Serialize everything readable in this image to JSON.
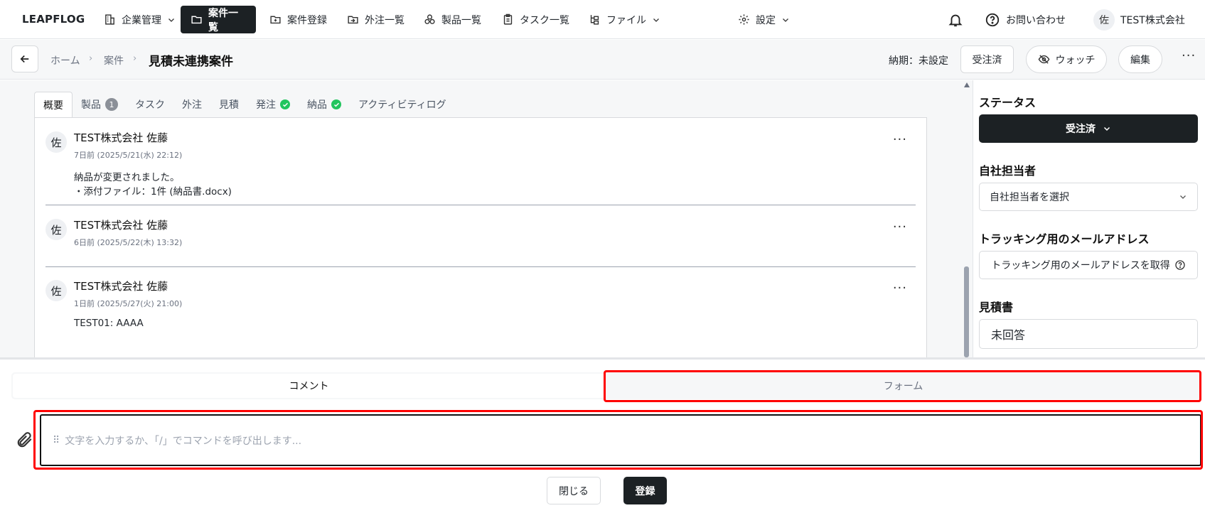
{
  "app": {
    "logo": "LEAPFLOG"
  },
  "nav": {
    "items": [
      {
        "label": "企業管理",
        "icon": "building-icon",
        "dropdown": true
      },
      {
        "label": "案件一覧",
        "icon": "folder-icon",
        "active": true
      },
      {
        "label": "案件登録",
        "icon": "folder-plus-icon"
      },
      {
        "label": "外注一覧",
        "icon": "folder-arrow-icon"
      },
      {
        "label": "製品一覧",
        "icon": "boxes-icon"
      },
      {
        "label": "タスク一覧",
        "icon": "clipboard-icon"
      },
      {
        "label": "ファイル",
        "icon": "file-tree-icon",
        "dropdown": true
      },
      {
        "label": "設定",
        "icon": "gear-icon",
        "dropdown": true
      }
    ],
    "contact_label": "お問い合わせ",
    "user_avatar": "佐",
    "user_company": "TEST株式会社"
  },
  "header": {
    "crumb_home": "ホーム",
    "crumb_projects": "案件",
    "title": "見積未連携案件",
    "deadline": "納期：未設定",
    "status_button": "受注済",
    "watch_button": "ウォッチ",
    "edit_button": "編集"
  },
  "tabs": [
    {
      "label": "概要",
      "active": true
    },
    {
      "label": "製品",
      "badge": "1"
    },
    {
      "label": "タスク"
    },
    {
      "label": "外注"
    },
    {
      "label": "見積"
    },
    {
      "label": "発注",
      "check": true
    },
    {
      "label": "納品",
      "check": true
    },
    {
      "label": "アクティビティログ"
    }
  ],
  "activity": [
    {
      "avatar": "佐",
      "author": "TEST株式会社  佐藤",
      "time": "7日前 (2025/5/21(水) 22:12)",
      "lines": [
        "納品が変更されました。",
        "・添付ファイル：1件 (納品書.docx)"
      ]
    },
    {
      "avatar": "佐",
      "author": "TEST株式会社  佐藤",
      "time": "6日前 (2025/5/22(木) 13:32)",
      "lines": []
    },
    {
      "avatar": "佐",
      "author": "TEST株式会社  佐藤",
      "time": "1日前 (2025/5/27(火) 21:00)",
      "lines": [
        "TEST01: AAAA"
      ]
    }
  ],
  "sidebar": {
    "status_title": "ステータス",
    "status_value": "受注済",
    "assignee_title": "自社担当者",
    "assignee_placeholder": "自社担当者を選択",
    "tracking_title": "トラッキング用のメールアドレス",
    "tracking_button": "トラッキング用のメールアドレスを取得",
    "estimate_title": "見積書",
    "estimate_value": "未回答"
  },
  "composer": {
    "tab_comment": "コメント",
    "tab_form": "フォーム",
    "placeholder": "文字を入力するか、「/」でコマンドを呼び出します...",
    "close_button": "閉じる",
    "submit_button": "登録"
  },
  "colors": {
    "dark": "#1c2124",
    "success": "#22c55e",
    "highlight": "#ff0000"
  }
}
